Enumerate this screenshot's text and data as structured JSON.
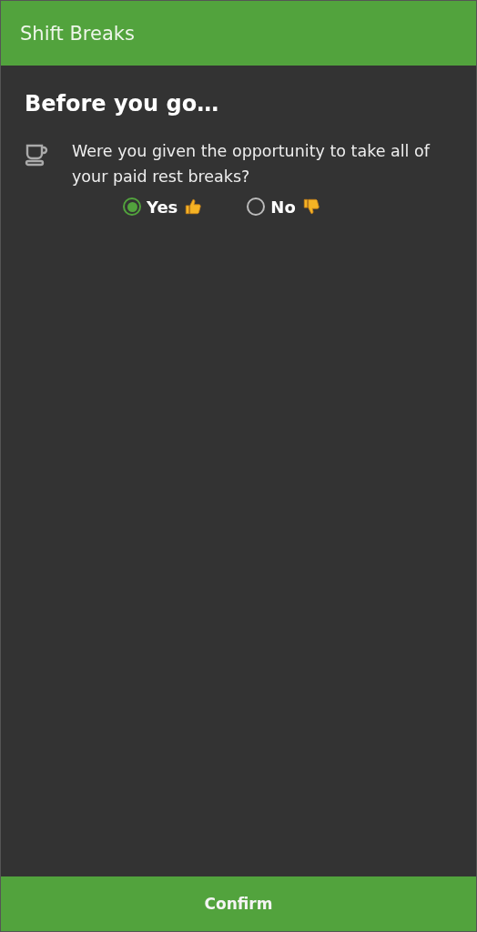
{
  "app_bar": {
    "title": "Shift Breaks"
  },
  "heading": "Before you go…",
  "question": {
    "text": "Were you given the opportunity to take all of your paid rest breaks?",
    "options": [
      {
        "label": "Yes",
        "kind": "thumbs-up",
        "selected": true
      },
      {
        "label": "No",
        "kind": "thumbs-down",
        "selected": false
      }
    ]
  },
  "confirm_button": "Confirm"
}
